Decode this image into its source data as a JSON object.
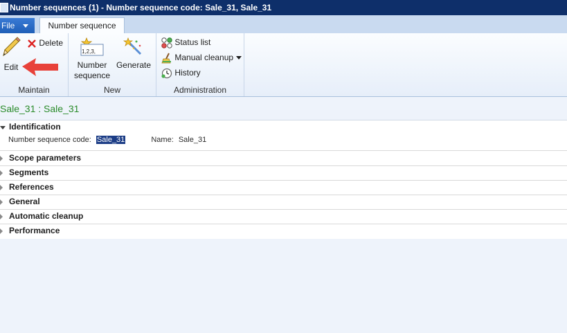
{
  "window": {
    "title": "Number sequences (1) - Number sequence code: Sale_31, Sale_31"
  },
  "tabs": {
    "file_label": "File",
    "active_tab": "Number sequence"
  },
  "ribbon": {
    "maintain": {
      "group_label": "Maintain",
      "edit_label": "Edit",
      "delete_label": "Delete"
    },
    "new": {
      "group_label": "New",
      "number_sequence_line1": "Number",
      "number_sequence_line2": "sequence",
      "generate_label": "Generate",
      "icon_text": "1,2,3,"
    },
    "administration": {
      "group_label": "Administration",
      "status_list_label": "Status list",
      "manual_cleanup_label": "Manual cleanup",
      "history_label": "History"
    }
  },
  "record": {
    "header": "Sale_31 : Sale_31"
  },
  "identification": {
    "title": "Identification",
    "code_label": "Number sequence code:",
    "code_value": "Sale_31",
    "name_label": "Name:",
    "name_value": "Sale_31"
  },
  "fasttabs": [
    "Scope parameters",
    "Segments",
    "References",
    "General",
    "Automatic cleanup",
    "Performance"
  ],
  "colors": {
    "title_bar": "#0e2f6a",
    "header_text": "#2a8b2a",
    "annotation_arrow": "#e8413a",
    "selection": "#1c3d86"
  }
}
